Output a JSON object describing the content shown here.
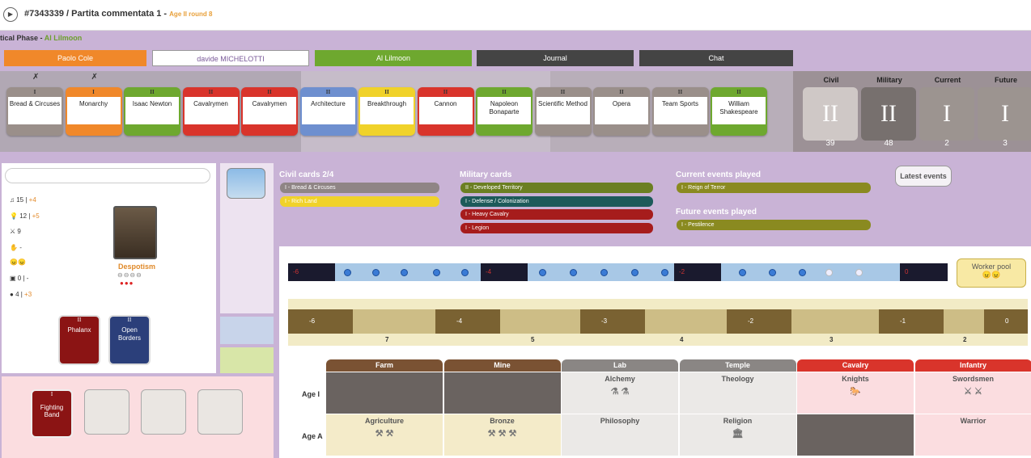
{
  "header": {
    "game_id": "#7343339 / Partita commentata 1",
    "age_round": "Age II round 8",
    "phase_label": "tical Phase -",
    "phase_player": "Al Lilmoon"
  },
  "players": [
    {
      "name": "Paolo Cole",
      "color": "#f0882a",
      "text": "#fff"
    },
    {
      "name": "davide MICHELOTTI",
      "color": "#ffffff",
      "text": "#7a5a99"
    },
    {
      "name": "Al Lilmoon",
      "color": "#6ea82f",
      "text": "#fff"
    },
    {
      "name": "Journal",
      "color": "#444444",
      "text": "#fff"
    },
    {
      "name": "Chat",
      "color": "#444444",
      "text": "#fff"
    }
  ],
  "card_row": [
    {
      "age": "I",
      "name": "Bread & Circuses",
      "color": "#9a8f8a",
      "x": "✗"
    },
    {
      "age": "I",
      "name": "Monarchy",
      "color": "#f0882a",
      "x": "✗"
    },
    {
      "age": "II",
      "name": "Isaac Newton",
      "color": "#6ea82f",
      "x": ""
    },
    {
      "age": "II",
      "name": "Cavalrymen",
      "color": "#d9342b",
      "x": ""
    },
    {
      "age": "II",
      "name": "Cavalrymen",
      "color": "#d9342b",
      "x": ""
    },
    {
      "age": "II",
      "name": "Architecture",
      "color": "#6e8fcf",
      "x": ""
    },
    {
      "age": "II",
      "name": "Breakthrough",
      "color": "#f0d22a",
      "x": ""
    },
    {
      "age": "II",
      "name": "Cannon",
      "color": "#d9342b",
      "x": ""
    },
    {
      "age": "II",
      "name": "Napoleon Bonaparte",
      "color": "#6ea82f",
      "x": ""
    },
    {
      "age": "II",
      "name": "Scientific Method",
      "color": "#9a8f8a",
      "x": ""
    },
    {
      "age": "II",
      "name": "Opera",
      "color": "#9a8f8a",
      "x": ""
    },
    {
      "age": "II",
      "name": "Team Sports",
      "color": "#9a8f8a",
      "x": ""
    },
    {
      "age": "II",
      "name": "William Shakespeare",
      "color": "#6ea82f",
      "x": ""
    }
  ],
  "decks": [
    {
      "label": "Civil",
      "age": "II",
      "count": "39",
      "color": "#cfc8c6"
    },
    {
      "label": "Military",
      "age": "II",
      "count": "48",
      "color": "#77706e"
    },
    {
      "label": "Current",
      "age": "I",
      "count": "2",
      "color": "#9c9490"
    },
    {
      "label": "Future",
      "age": "I",
      "count": "3",
      "color": "#9c9490"
    }
  ],
  "stats": {
    "culture": "15",
    "culture_plus": "+4",
    "science": "12",
    "science_plus": "+5",
    "military": "9",
    "happy": "-",
    "happy_faces": "😠😠",
    "resources": "0",
    "resources_plus": "-",
    "food": "4",
    "food_plus": "+3"
  },
  "leader": {
    "government": "Despotism",
    "civil_dots": "⊖⊖⊖⊖",
    "military_dots": "●●●"
  },
  "tactics": [
    {
      "age": "II",
      "name": "Phalanx",
      "color": "#8b1414"
    },
    {
      "age": "II",
      "name": "Open Borders",
      "color": "#2b3f7a"
    }
  ],
  "bottom_card": {
    "age": "I",
    "name": "Fighting Band"
  },
  "hand": {
    "civil_title": "Civil cards 2/4",
    "civil": [
      {
        "name": "I - Bread & Circuses",
        "color": "#8f8585"
      },
      {
        "name": "I - Rich Land",
        "color": "#f0d22a"
      }
    ],
    "military_title": "Military cards",
    "military": [
      {
        "name": "II - Developed Territory",
        "color": "#6b7f22"
      },
      {
        "name": "I - Defense / Colonization",
        "color": "#1d5a5a"
      },
      {
        "name": "I - Heavy Cavalry",
        "color": "#a61c1c"
      },
      {
        "name": "I - Legion",
        "color": "#a61c1c"
      }
    ],
    "current_title": "Current events played",
    "current": [
      {
        "name": "I - Reign of Terror",
        "color": "#8a8a20"
      }
    ],
    "future_title": "Future events played",
    "future": [
      {
        "name": "I - Pestilence",
        "color": "#8a8a20"
      }
    ],
    "latest_label": "Latest events"
  },
  "pool": {
    "blocks": [
      "-6",
      "-4",
      "-2",
      "0"
    ],
    "worker_pool": "Worker pool",
    "worker_faces": "😠😠"
  },
  "food_track": {
    "blocks": [
      "-6",
      "-4",
      "-3",
      "-2",
      "-1",
      "0"
    ],
    "costs": [
      "7",
      "5",
      "4",
      "3",
      "2"
    ]
  },
  "techs": {
    "headers": [
      {
        "name": "Farm",
        "color": "#7a5233"
      },
      {
        "name": "Mine",
        "color": "#7a5233"
      },
      {
        "name": "Lab",
        "color": "#8a8684"
      },
      {
        "name": "Temple",
        "color": "#8a8684"
      },
      {
        "name": "Cavalry",
        "color": "#d9342b"
      },
      {
        "name": "Infantry",
        "color": "#d9342b"
      }
    ],
    "rows": [
      {
        "age": "Age I",
        "cells": [
          {
            "name": "",
            "bg": "#6a6360"
          },
          {
            "name": "",
            "bg": "#6a6360"
          },
          {
            "name": "Alchemy",
            "bg": "#ebe9e7",
            "icon": "⚗ ⚗"
          },
          {
            "name": "Theology",
            "bg": "#ebe9e7",
            "icon": ""
          },
          {
            "name": "Knights",
            "bg": "#fbdde0",
            "icon": "🐎"
          },
          {
            "name": "Swordsmen",
            "bg": "#fbdde0",
            "icon": "⚔ ⚔"
          }
        ]
      },
      {
        "age": "Age A",
        "cells": [
          {
            "name": "Agriculture",
            "bg": "#f4ebc9",
            "icon": "⚒ ⚒"
          },
          {
            "name": "Bronze",
            "bg": "#f4ebc9",
            "icon": "⚒ ⚒ ⚒"
          },
          {
            "name": "Philosophy",
            "bg": "#ebe9e7",
            "icon": ""
          },
          {
            "name": "Religion",
            "bg": "#ebe9e7",
            "icon": "🏛"
          },
          {
            "name": "",
            "bg": "#6a6360",
            "icon": ""
          },
          {
            "name": "Warrior",
            "bg": "#fbdde0",
            "icon": ""
          }
        ]
      }
    ]
  }
}
